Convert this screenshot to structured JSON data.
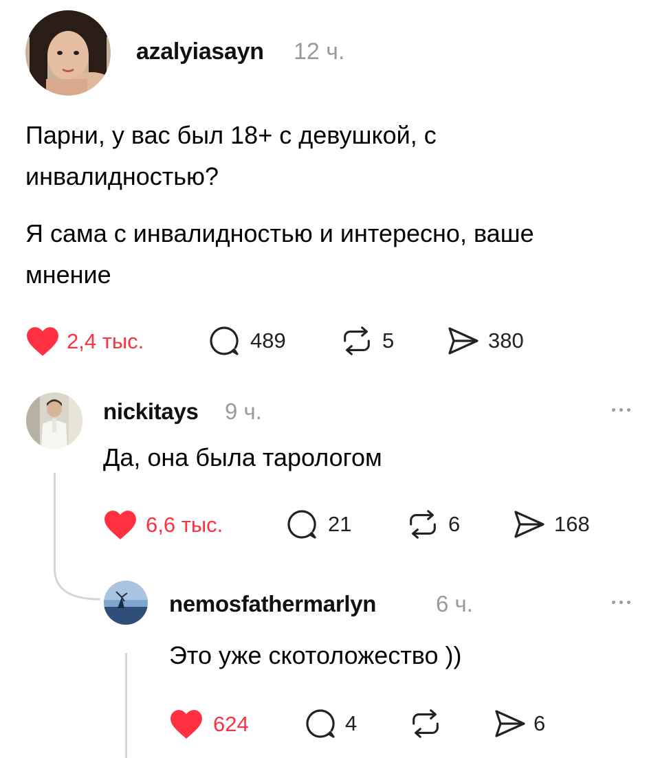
{
  "post": {
    "username": "azalyiasayn",
    "time": "12 ч.",
    "text_line_1": "Парни, у вас был 18+ с девушкой, с",
    "text_line_2": "инвалидностью?",
    "text_line_3": "Я сама с инвалидностью и интересно, ваше",
    "text_line_4": "мнение",
    "likes": "2,4 тыс.",
    "comments": "489",
    "reposts": "5",
    "shares": "380"
  },
  "reply_1": {
    "username": "nickitays",
    "time": "9 ч.",
    "text": "Да, она была тарологом",
    "likes": "6,6 тыс.",
    "comments": "21",
    "reposts": "6",
    "shares": "168"
  },
  "reply_2": {
    "username": "nemosfathermarlyn",
    "time": "6 ч.",
    "text": "Это уже скотоложество ))",
    "likes": "624",
    "comments": "4",
    "reposts": "",
    "shares": "6"
  },
  "colors": {
    "like_red": "#ff3040",
    "muted_gray": "#9a9a9a",
    "thread_line": "#d6d6d6"
  },
  "icons": [
    "heart-icon",
    "comment-icon",
    "repost-icon",
    "share-icon",
    "more-icon"
  ]
}
